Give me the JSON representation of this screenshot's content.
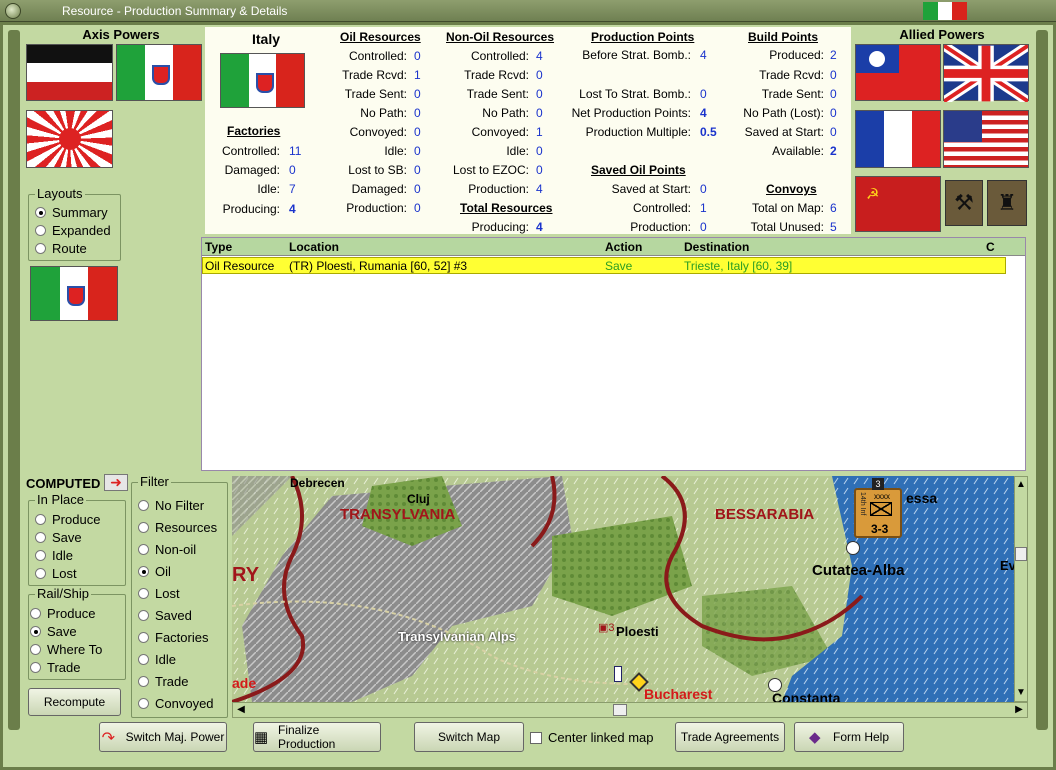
{
  "window": {
    "title": "Resource - Production Summary & Details"
  },
  "axis": {
    "title": "Axis Powers"
  },
  "allied": {
    "title": "Allied Powers"
  },
  "layouts": {
    "caption": "Layouts",
    "options": [
      "Summary",
      "Expanded",
      "Route"
    ],
    "selected": "Summary"
  },
  "country": {
    "name": "Italy"
  },
  "factories": {
    "heading": "Factories",
    "rows": [
      {
        "label": "Controlled:",
        "value": "11"
      },
      {
        "label": "Damaged:",
        "value": "0"
      },
      {
        "label": "Idle:",
        "value": "7"
      },
      {
        "label": "Producing:",
        "value": "4"
      }
    ]
  },
  "oil": {
    "heading": "Oil Resources",
    "rows": [
      {
        "label": "Controlled:",
        "value": "0"
      },
      {
        "label": "Trade Rcvd:",
        "value": "1"
      },
      {
        "label": "Trade Sent:",
        "value": "0"
      },
      {
        "label": "No Path:",
        "value": "0"
      },
      {
        "label": "Convoyed:",
        "value": "0"
      },
      {
        "label": "Idle:",
        "value": "0"
      },
      {
        "label": "Lost to SB:",
        "value": "0"
      },
      {
        "label": "Damaged:",
        "value": "0"
      },
      {
        "label": "Production:",
        "value": "0"
      }
    ]
  },
  "nonoil": {
    "heading": "Non-Oil Resources",
    "rows": [
      {
        "label": "Controlled:",
        "value": "4"
      },
      {
        "label": "Trade Rcvd:",
        "value": "0"
      },
      {
        "label": "Trade Sent:",
        "value": "0"
      },
      {
        "label": "No Path:",
        "value": "0"
      },
      {
        "label": "Convoyed:",
        "value": "1"
      },
      {
        "label": "Idle:",
        "value": "0"
      },
      {
        "label": "Lost to EZOC:",
        "value": "0"
      },
      {
        "label": "Production:",
        "value": "4"
      }
    ]
  },
  "total": {
    "heading": "Total Resources",
    "label": "Producing:",
    "value": "4"
  },
  "pp": {
    "heading": "Production Points",
    "before_label": "Before Strat. Bomb.:",
    "before": "4",
    "lost_label": "Lost To Strat. Bomb.:",
    "lost": "0",
    "net_label": "Net Production Points:",
    "net": "4",
    "mult_label": "Production Multiple:",
    "mult": "0.5"
  },
  "savedoil": {
    "heading": "Saved Oil Points",
    "rows": [
      {
        "label": "Saved at Start:",
        "value": "0"
      },
      {
        "label": "Controlled:",
        "value": "1"
      },
      {
        "label": "Production:",
        "value": "0"
      }
    ]
  },
  "build": {
    "heading": "Build Points",
    "rows": [
      {
        "label": "Produced:",
        "value": "2"
      },
      {
        "label": "Trade Rcvd:",
        "value": "0"
      },
      {
        "label": "Trade Sent:",
        "value": "0"
      },
      {
        "label": "No Path (Lost):",
        "value": "0"
      },
      {
        "label": "Saved at Start:",
        "value": "0"
      },
      {
        "label": "Available:",
        "value": "2"
      }
    ]
  },
  "convoys": {
    "heading": "Convoys",
    "rows": [
      {
        "label": "Total on Map:",
        "value": "6"
      },
      {
        "label": "Total Unused:",
        "value": "5"
      }
    ]
  },
  "table": {
    "headers": [
      "Type",
      "Location",
      "Action",
      "Destination",
      "C"
    ],
    "rows": [
      {
        "type": "Oil Resource",
        "location": "(TR) Ploesti, Rumania [60, 52] #3",
        "action": "Save",
        "destination": "Trieste, Italy [60, 39]"
      }
    ]
  },
  "computed": {
    "label": "COMPUTED"
  },
  "inplace": {
    "caption": "In Place",
    "options": [
      "Produce",
      "Save",
      "Idle",
      "Lost"
    ],
    "selected": ""
  },
  "railship": {
    "caption": "Rail/Ship",
    "options": [
      "Produce",
      "Save",
      "Where To",
      "Trade"
    ],
    "selected": "Save"
  },
  "filter": {
    "caption": "Filter",
    "options": [
      "No Filter",
      "Resources",
      "Non-oil",
      "Oil",
      "Lost",
      "Saved",
      "Factories",
      "Idle",
      "Trade",
      "Convoyed"
    ],
    "selected": "Oil"
  },
  "recompute": {
    "label": "Recompute"
  },
  "map": {
    "labels": {
      "debrecen": "Debrecen",
      "cluj": "Cluj",
      "transylvania": "TRANSYLVANIA",
      "bessarabia": "BESSARABIA",
      "alps": "Transylvanian Alps",
      "ploesti": "Ploesti",
      "bucharest": "Bucharest",
      "cutatea": "Cutatea-Alba",
      "constanta": "Constanta",
      "odessa": "essa",
      "ry": "RY",
      "ade": "ade",
      "ev": "Ev"
    },
    "unit": {
      "type": "xxxx",
      "strength": "3-3",
      "side": "14th Inf",
      "count": "3"
    },
    "ploesti_count": "3"
  },
  "buttons": {
    "switch": "Switch Maj. Power",
    "finalize": "Finalize Production",
    "switchmap": "Switch Map",
    "center": "Center linked map",
    "trade": "Trade Agreements",
    "help": "Form Help"
  },
  "colors": {
    "italy_green": "#1fa23a",
    "italy_red": "#d8241c",
    "header_green": "#b6d7a0",
    "highlight": "#ffff33",
    "value_blue": "#1a33cc"
  }
}
